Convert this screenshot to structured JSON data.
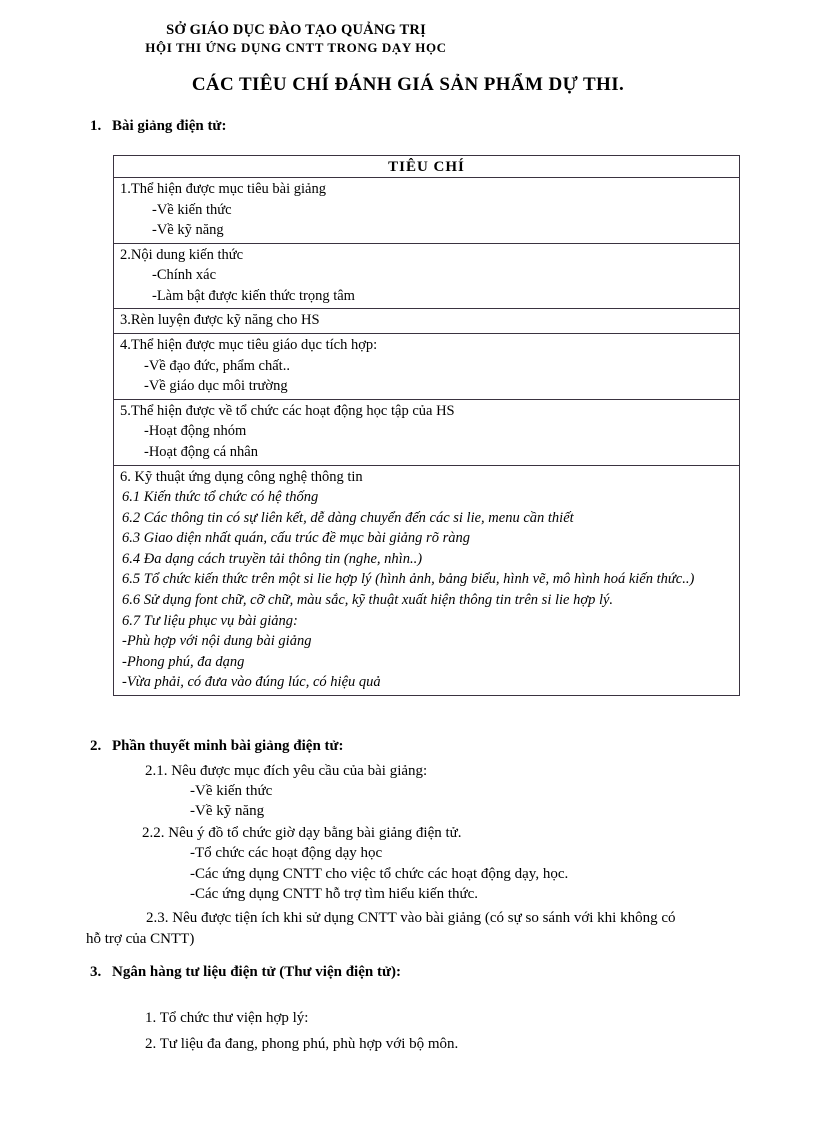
{
  "letterhead": {
    "line1": "SỞ GIÁO DỤC ĐÀO TẠO QUẢNG TRỊ",
    "line2": "HỘI THI ỨNG DỤNG  CNTT  TRONG  DẠY HỌC"
  },
  "doc_title": "CÁC TIÊU CHÍ ĐÁNH GIÁ SẢN PHẨM DỰ THI.",
  "sections": {
    "s1": {
      "num": "1.",
      "title": "Bài giảng điện tử:"
    },
    "s2": {
      "num": "2.",
      "title": "Phần thuyết minh bài giảng điện tử:"
    },
    "s3": {
      "num": "3.",
      "title": "Ngân hàng tư liệu điện tử (Thư viện điện tử):"
    }
  },
  "table": {
    "header": "TIÊU  CHÍ",
    "rows": [
      {
        "lines": [
          {
            "text": "1.Thể hiện được mục tiêu bài giảng",
            "style": "plain"
          },
          {
            "text": "-Về kiến thức",
            "style": "indent1"
          },
          {
            "text": "-Về kỹ năng",
            "style": "indent1"
          }
        ]
      },
      {
        "lines": [
          {
            "text": "2.Nội dung kiến thức",
            "style": "plain"
          },
          {
            "text": "-Chính xác",
            "style": "indent1"
          },
          {
            "text": "-Làm bật được kiến thức trọng tâm",
            "style": "indent1"
          }
        ]
      },
      {
        "lines": [
          {
            "text": "3.Rèn luyện được kỹ năng cho HS",
            "style": "plain"
          }
        ]
      },
      {
        "lines": [
          {
            "text": "4.Thể hiện được mục tiêu giáo dục tích hợp:",
            "style": "plain"
          },
          {
            "text": "-Về đạo đức, phẩm chất..",
            "style": "indent2"
          },
          {
            "text": "-Về giáo dục môi trường",
            "style": "indent2"
          }
        ]
      },
      {
        "lines": [
          {
            "text": "5.Thể hiện được về tổ chức các hoạt động học tập của HS",
            "style": "plain"
          },
          {
            "text": "-Hoạt động nhóm",
            "style": "indent2"
          },
          {
            "text": "-Hoạt động cá nhân",
            "style": "indent2"
          }
        ]
      },
      {
        "lines": [
          {
            "text": "6. Kỹ thuật ứng dụng công nghệ thông tin",
            "style": "plain"
          },
          {
            "text": "6.1 Kiến thức tổ chức có hệ thống",
            "style": "italic"
          },
          {
            "text": "6.2 Các thông tin có sự liên kết, dễ dàng chuyển đến các si lie, menu cần thiết",
            "style": "italic"
          },
          {
            "text": "6.3 Giao diện nhất quán, cấu trúc đề mục bài giảng rõ ràng",
            "style": "italic"
          },
          {
            "text": "6.4 Đa dạng cách truyền tải thông tin (nghe, nhìn..)",
            "style": "italic"
          },
          {
            "text": "6.5 Tổ chức kiến thức trên một si lie hợp lý (hình ảnh, bảng biểu, hình vẽ, mô hình hoá kiến thức..)",
            "style": "italic-wrap"
          },
          {
            "text": "6.6 Sử dụng font chữ, cỡ chữ, màu sắc, kỹ thuật xuất hiện thông tin trên si lie hợp lý.",
            "style": "italic"
          },
          {
            "text": "6.7 Tư liệu phục vụ bài giảng:",
            "style": "italic"
          },
          {
            "text": "-Phù hợp với nội dung bài giảng",
            "style": "italic-indent"
          },
          {
            "text": "-Phong phú, đa dạng",
            "style": "italic-indent"
          },
          {
            "text": "-Vừa phải, có đưa vào đúng lúc, có hiệu quả",
            "style": "italic-indent"
          }
        ]
      }
    ]
  },
  "section2_items": {
    "i21": "2.1. Nêu được mục đích yêu cầu của bài giảng:",
    "i21a": "-Về kiến thức",
    "i21b": "-Về kỹ năng",
    "i22": "2.2.  Nêu ý đồ tổ chức giờ dạy bằng bài giảng điện tử.",
    "i22a": "-Tổ chức các hoạt động dạy học",
    "i22b": "-Các ứng dụng  CNTT  cho việc tổ chức các hoạt động dạy, học.",
    "i22c": "-Các ứng dụng  CNTT  hỗ trợ tìm hiểu kiến thức.",
    "i23": "2.3. Nêu được tiện ích khi sử dụng  CNTT  vào bài giảng (có sự so sánh với khi không có",
    "i23b": "hỗ trợ của CNTT)"
  },
  "section3_items": {
    "i31": "1. Tổ chức thư viện hợp lý:",
    "i32": "2. Tư liệu đa đang, phong phú, phù hợp với bộ môn."
  },
  "colors": {
    "text": "#000000",
    "table_border": "#3a3340",
    "background": "#ffffff"
  }
}
